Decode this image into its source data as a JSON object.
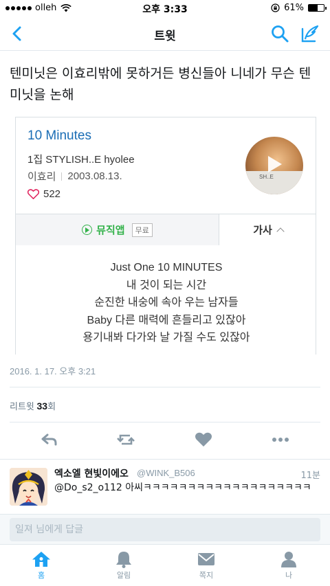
{
  "status_bar": {
    "carrier": "olleh",
    "time": "오후 3:33",
    "battery_percent": "61%",
    "battery_level": 0.61
  },
  "nav": {
    "title": "트윗"
  },
  "tweet": {
    "text": "텐미닛은 이효리밖에 못하거든 병신들아 니네가 무슨 텐미닛을 논해",
    "timestamp": "2016. 1. 17. 오후 3:21",
    "retweet_label": "리트윗",
    "retweet_count": "33",
    "retweet_suffix": "회"
  },
  "card": {
    "song_title": "10 Minutes",
    "album": "1집 STYLISH..E hyolee",
    "artist": "이효리",
    "release_date": "2003.08.13.",
    "likes": "522",
    "album_art_text": "SH..E",
    "music_app_label": "뮤직앱",
    "free_badge": "무료",
    "lyrics_tab_label": "가사",
    "lyrics_lines": [
      "Just One 10 MINUTES",
      "내 것이 되는 시간",
      "순진한 내숭에 속아 우는 남자들",
      "Baby 다른 매력에 흔들리고 있잖아",
      "용기내봐 다가와 날 가질 수도 있잖아"
    ]
  },
  "reply": {
    "name": "엑소엘 현빛이에오",
    "handle": "@WINK_B506",
    "time": "11분",
    "text": "@Do_s2_o112 아씨ㅋㅋㅋㅋㅋㅋㅋㅋㅋㅋㅋㅋㅋㅋㅋㅋㅋㅋㅋ"
  },
  "reply_input": {
    "placeholder": "일져 님에게 답글"
  },
  "tab_bar": {
    "home": "홈",
    "notifications": "알림",
    "messages": "쪽지",
    "me": "나"
  },
  "colors": {
    "accent": "#1da1f2",
    "link": "#1a6db5",
    "music_green": "#33b24a",
    "muted": "#8899a6"
  }
}
